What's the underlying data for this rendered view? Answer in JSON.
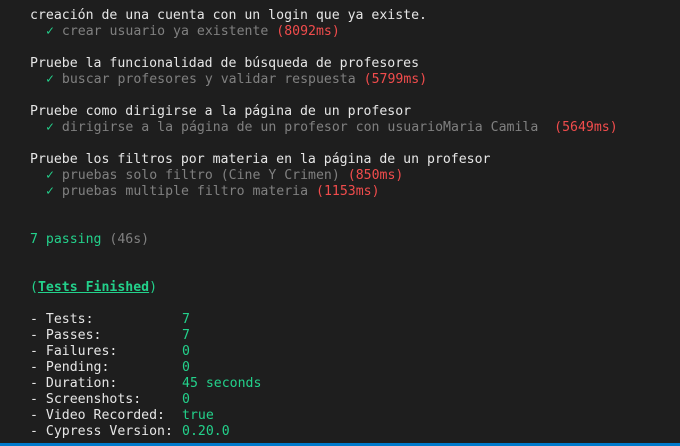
{
  "suites": [
    {
      "title": "creación de una cuenta con un login que ya existe.",
      "tests": [
        {
          "check": "✓",
          "name": "crear usuario ya existente",
          "duration": "(8092ms)"
        }
      ]
    },
    {
      "title": "Pruebe la funcionalidad de búsqueda de profesores",
      "tests": [
        {
          "check": "✓",
          "name": "buscar profesores y validar respuesta",
          "duration": "(5799ms)"
        }
      ]
    },
    {
      "title": "Pruebe como dirigirse a la página de un profesor",
      "tests": [
        {
          "check": "✓",
          "name": "dirigirse a la página de un profesor con usuarioMaria Camila ",
          "duration": "(5649ms)"
        }
      ]
    },
    {
      "title": "Pruebe los filtros por materia en la página de un profesor",
      "tests": [
        {
          "check": "✓",
          "name": "pruebas solo filtro (Cine Y Crimen)",
          "duration": "(850ms)"
        },
        {
          "check": "✓",
          "name": "pruebas multiple filtro materia",
          "duration": "(1153ms)"
        }
      ]
    }
  ],
  "summary": {
    "passing": "7 passing",
    "time": "(46s)"
  },
  "finished": {
    "open_paren": "(",
    "label": "Tests Finished",
    "close_paren": ")"
  },
  "stats": [
    {
      "label": "- Tests:",
      "value": "7"
    },
    {
      "label": "- Passes:",
      "value": "7"
    },
    {
      "label": "- Failures:",
      "value": "0"
    },
    {
      "label": "- Pending:",
      "value": "0"
    },
    {
      "label": "- Duration:",
      "value": "45 seconds"
    },
    {
      "label": "- Screenshots:",
      "value": "0"
    },
    {
      "label": "- Video Recorded:",
      "value": "true"
    },
    {
      "label": "- Cypress Version:",
      "value": "0.20.0"
    }
  ],
  "colors": {
    "background": "#1e1e1e",
    "pass_green": "#23d18b",
    "duration_red": "#f14c4c",
    "muted_gray": "#808080",
    "status_bar_blue": "#007acc"
  }
}
